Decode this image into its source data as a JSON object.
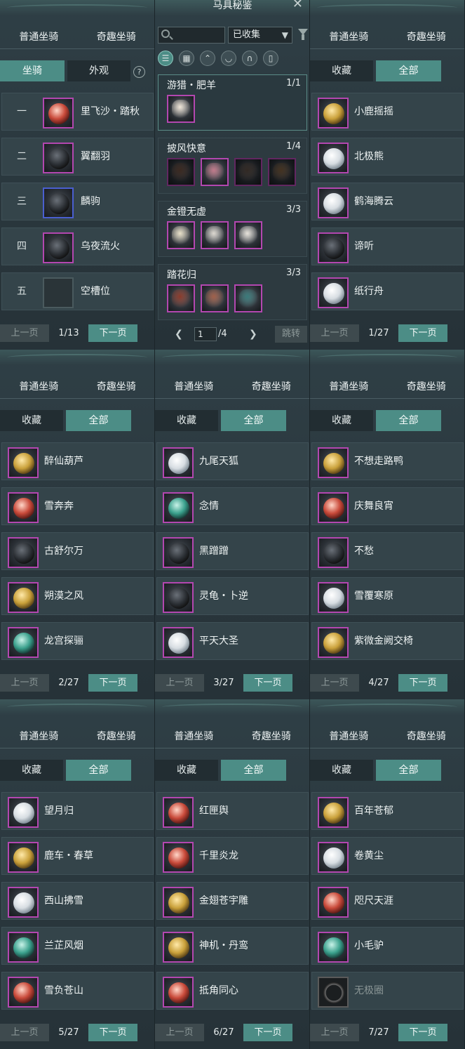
{
  "codex": {
    "title": "马具秘鉴",
    "search_placeholder": "",
    "filter_selected": "已收集",
    "category_icons": [
      "list-icon",
      "grid-icon",
      "saddle-icon",
      "bridle-icon",
      "horseshoe-icon",
      "stirrup-icon"
    ],
    "sets": [
      {
        "name": "游猎・肥羊",
        "count": "1/1",
        "items": 1
      },
      {
        "name": "披风快意",
        "count": "1/4",
        "items": 4
      },
      {
        "name": "金镫无虚",
        "count": "3/3",
        "items": 3
      },
      {
        "name": "踏花归",
        "count": "3/3",
        "items": 3
      }
    ],
    "page_input": "1",
    "page_total": "/4",
    "jump_label": "跳转"
  },
  "labels": {
    "tab_normal": "普通坐骑",
    "tab_fun": "奇趣坐骑",
    "sub_mount": "坐骑",
    "sub_look": "外观",
    "sub_fav": "收藏",
    "sub_all": "全部",
    "help": "?",
    "prev": "上一页",
    "next": "下一页"
  },
  "panels": [
    {
      "id": "p1",
      "col": 0,
      "row": 0,
      "kind": "slots",
      "page": "1/13",
      "items": [
        {
          "num": "一",
          "name": "里飞沙・踏秋",
          "color": "red"
        },
        {
          "num": "二",
          "name": "翼翻羽",
          "color": "blk"
        },
        {
          "num": "三",
          "name": "麟驹",
          "color": "blk",
          "border": "blue"
        },
        {
          "num": "四",
          "name": "乌夜流火",
          "color": "blk"
        },
        {
          "num": "五",
          "name": "空槽位",
          "color": "",
          "empty": true
        }
      ]
    },
    {
      "id": "p3",
      "col": 2,
      "row": 0,
      "kind": "fun",
      "page": "1/27",
      "items": [
        {
          "name": "小鹿摇摇",
          "color": "gold"
        },
        {
          "name": "北极熊",
          "color": "wht"
        },
        {
          "name": "鹤海腾云",
          "color": "wht"
        },
        {
          "name": "谛听",
          "color": "blk"
        },
        {
          "name": "纸行舟",
          "color": "wht"
        }
      ]
    },
    {
      "id": "p4",
      "col": 0,
      "row": 1,
      "kind": "fun",
      "page": "2/27",
      "items": [
        {
          "name": "醉仙葫芦",
          "color": "gold"
        },
        {
          "name": "雪奔奔",
          "color": "red"
        },
        {
          "name": "古舒尔万",
          "color": "blk"
        },
        {
          "name": "朔漠之风",
          "color": "gold"
        },
        {
          "name": "龙宫探骊",
          "color": "teal"
        }
      ]
    },
    {
      "id": "p5",
      "col": 1,
      "row": 1,
      "kind": "fun",
      "page": "3/27",
      "items": [
        {
          "name": "九尾天狐",
          "color": "wht"
        },
        {
          "name": "念情",
          "color": "teal"
        },
        {
          "name": "黑蹭蹭",
          "color": "blk"
        },
        {
          "name": "灵龟・卜逆",
          "color": "blk"
        },
        {
          "name": "平天大圣",
          "color": "wht"
        }
      ]
    },
    {
      "id": "p6",
      "col": 2,
      "row": 1,
      "kind": "fun",
      "page": "4/27",
      "items": [
        {
          "name": "不想走路鸭",
          "color": "gold"
        },
        {
          "name": "庆舞良宵",
          "color": "red"
        },
        {
          "name": "不愁",
          "color": "blk"
        },
        {
          "name": "雪覆寒原",
          "color": "wht"
        },
        {
          "name": "紫微金阙交椅",
          "color": "gold"
        }
      ]
    },
    {
      "id": "p7",
      "col": 0,
      "row": 2,
      "kind": "fun",
      "page": "5/27",
      "items": [
        {
          "name": "望月归",
          "color": "wht"
        },
        {
          "name": "鹿车・春草",
          "color": "gold"
        },
        {
          "name": "西山拂雪",
          "color": "wht"
        },
        {
          "name": "兰芷风烟",
          "color": "teal"
        },
        {
          "name": "雪负苍山",
          "color": "red"
        }
      ]
    },
    {
      "id": "p8",
      "col": 1,
      "row": 2,
      "kind": "fun",
      "page": "6/27",
      "items": [
        {
          "name": "红匣舆",
          "color": "red"
        },
        {
          "name": "千里炎龙",
          "color": "red"
        },
        {
          "name": "金翅苍宇雕",
          "color": "gold"
        },
        {
          "name": "神机・丹鸾",
          "color": "gold"
        },
        {
          "name": "抵角同心",
          "color": "red"
        }
      ]
    },
    {
      "id": "p9",
      "col": 2,
      "row": 2,
      "kind": "fun",
      "page": "7/27",
      "items": [
        {
          "name": "百年苍郁",
          "color": "gold"
        },
        {
          "name": "卷黄尘",
          "color": "wht"
        },
        {
          "name": "咫尺天涯",
          "color": "red"
        },
        {
          "name": "小毛驴",
          "color": "teal"
        },
        {
          "name": "无极圈",
          "color": "ring",
          "dim": true
        }
      ]
    }
  ]
}
